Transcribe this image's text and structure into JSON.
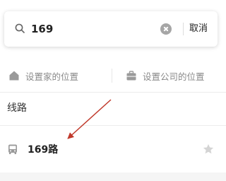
{
  "search": {
    "value": "169",
    "cancel_label": "取消"
  },
  "quick": {
    "home_label": "设置家的位置",
    "company_label": "设置公司的位置"
  },
  "section": {
    "title": "线路"
  },
  "results": [
    {
      "name": "169路",
      "icon": "bus-icon",
      "favorite_icon": "star-icon"
    }
  ],
  "colors": {
    "annotation_arrow": "#c0392b",
    "muted_text": "#8a8a8a",
    "icon_gray": "#9a9a9a",
    "star_gray": "#d4d4d4"
  }
}
